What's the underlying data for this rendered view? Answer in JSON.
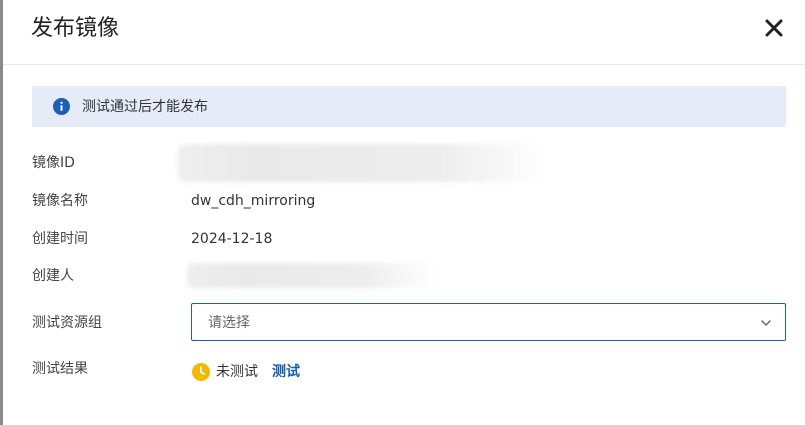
{
  "dialog": {
    "title": "发布镜像",
    "close_icon": "close-icon"
  },
  "notice": {
    "icon": "info-icon",
    "icon_color": "#1a5fb4",
    "background": "#e5ecf7",
    "text": "测试通过后才能发布"
  },
  "fields": {
    "image_id": {
      "label": "镜像ID",
      "value": ""
    },
    "image_name": {
      "label": "镜像名称",
      "value": "dw_cdh_mirroring"
    },
    "created_time": {
      "label": "创建时间",
      "value": "2024-12-18"
    },
    "creator": {
      "label": "创建人",
      "value": ""
    },
    "test_resource_group": {
      "label": "测试资源组",
      "placeholder": "请选择"
    },
    "test_result": {
      "label": "测试结果",
      "status_icon": "clock-icon",
      "status_color": "#f5b800",
      "status_text": "未测试",
      "action_label": "测试",
      "action_color": "#1a5fb4"
    }
  },
  "colors": {
    "accent": "#1a5fb4",
    "select_border": "#1f5fa8"
  }
}
